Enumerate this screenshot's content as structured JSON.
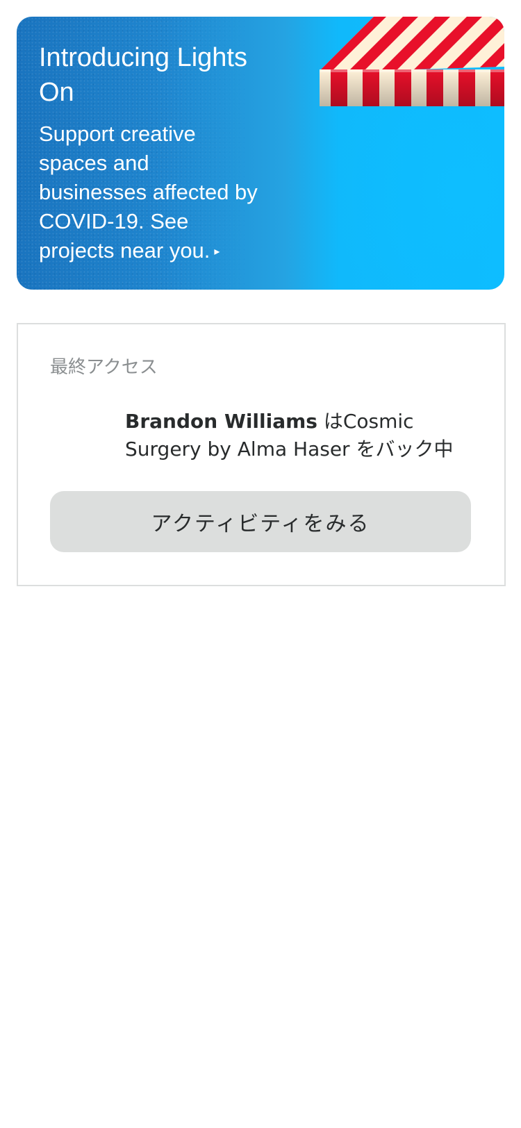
{
  "promo": {
    "title": "Introducing Lights On",
    "body": "Support creative spaces and businesses affected by COVID-19. See projects near you.",
    "arrow_icon": "play-triangle-icon",
    "colors": {
      "bg_left": "#1a74bf",
      "bg_right": "#0ebcff",
      "awning_red": "#e8102a",
      "awning_cream": "#fff1d8"
    }
  },
  "recent_activity": {
    "label": "最終アクセス",
    "backer_name": "Brandon Williams",
    "particle": " は",
    "project": "Cosmic Surgery by Alma Haser",
    "suffix": " をバック中",
    "button_label": "アクティビティをみる"
  }
}
